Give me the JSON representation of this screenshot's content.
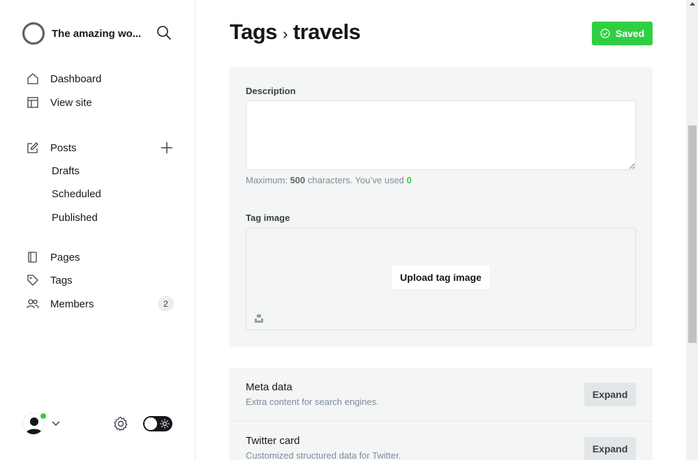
{
  "site": {
    "title": "The amazing wo..."
  },
  "nav": {
    "dashboard": "Dashboard",
    "view_site": "View site",
    "posts": "Posts",
    "drafts": "Drafts",
    "scheduled": "Scheduled",
    "published": "Published",
    "pages": "Pages",
    "tags": "Tags",
    "members": "Members",
    "members_count": "2"
  },
  "header": {
    "breadcrumb_parent": "Tags",
    "breadcrumb_separator": "›",
    "breadcrumb_current": "travels",
    "saved_label": "Saved"
  },
  "form": {
    "description_label": "Description",
    "description_value": "",
    "hint_prefix": "Maximum: ",
    "hint_max": "500",
    "hint_mid": " characters. You’ve used ",
    "hint_used": "0",
    "tag_image_label": "Tag image",
    "upload_label": "Upload tag image"
  },
  "cards": [
    {
      "title": "Meta data",
      "description": "Extra content for search engines.",
      "button": "Expand"
    },
    {
      "title": "Twitter card",
      "description": "Customized structured data for Twitter.",
      "button": "Expand"
    }
  ],
  "colors": {
    "accent_green": "#30cf43",
    "panel_bg": "#f4f5f5"
  }
}
